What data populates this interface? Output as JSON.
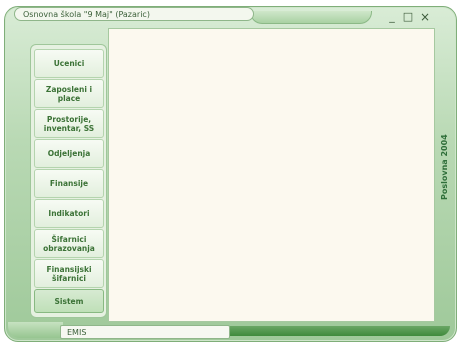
{
  "window": {
    "title": "Osnovna škola \"9 Maj\" (Pazaric)",
    "controls": {
      "minimize": "_",
      "maximize": "□",
      "close": "×"
    }
  },
  "sidebar": {
    "items": [
      {
        "label": "Ucenici"
      },
      {
        "label": "Zaposleni i place"
      },
      {
        "label": "Prostorije, inventar, SS"
      },
      {
        "label": "Odjeljenja"
      },
      {
        "label": "Finansije"
      },
      {
        "label": "Indikatori"
      },
      {
        "label": "Šifarnici obrazovanja"
      },
      {
        "label": "Finansijski šifarnici"
      },
      {
        "label": "Sistem"
      }
    ]
  },
  "side_label": "Poslovna 2004",
  "statusbar": {
    "text": "EMIS"
  },
  "colors": {
    "accent": "#3b7236",
    "shell": "#b9d9b4",
    "content_bg": "#fcf9ef"
  }
}
